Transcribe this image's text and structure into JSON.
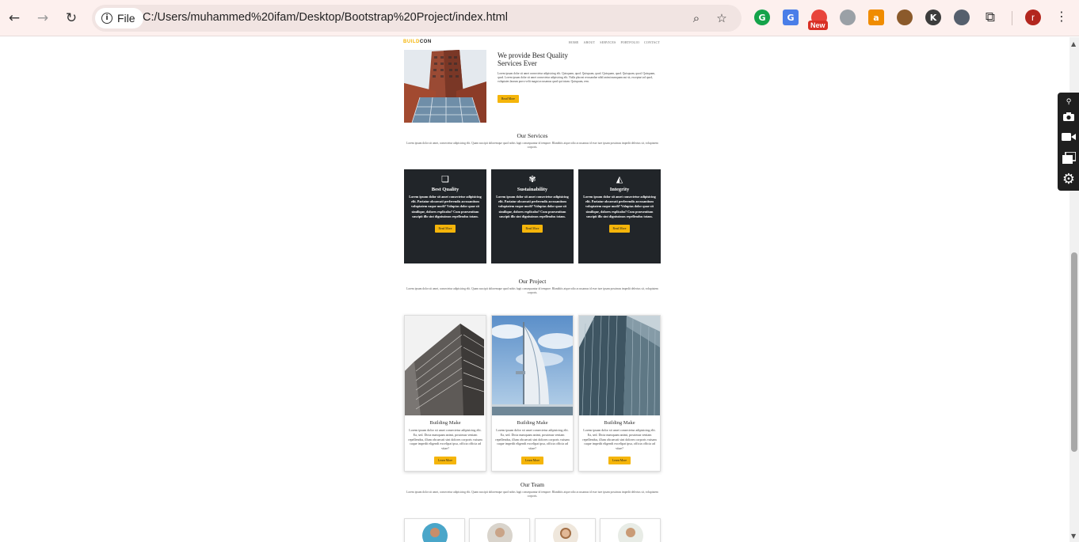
{
  "browser": {
    "file_label": "File",
    "url": "C:/Users/muhammed%20ifam/Desktop/Bootstrap%20Project/index.html",
    "new_badge": "New",
    "profile_initial": "r",
    "ext_k_letter": "K",
    "icons": {
      "back": "←",
      "forward": "→",
      "reload": "↻",
      "zoom": "⌕",
      "star": "☆",
      "puzzle": "⧉",
      "menu": "⋮",
      "info": "i"
    }
  },
  "site": {
    "brand_part1": "BUILD",
    "brand_part2": "CON",
    "nav": [
      "HOME",
      "ABOUT",
      "SERVICES",
      "PORTFOLIO",
      "CONTACT"
    ],
    "about": {
      "title": "We provide Best Quality Services Ever",
      "body": "Lorem ipsum dolor sit amet consectetur adipisicing elit. Quisquam, quod. Quisquam, quod. Quisquam, quod. Quisquam, quod. Quisquam, quod. Lorem ipsum dolor sit amet consectetur adipisicing elit. Nulla placeat recusandae nihil animi numquam aut sit, excepturi ad quod, voluptates laurum porro velit magni accusamus quod qui totam. Quisquam, rem.",
      "button": "Read More"
    },
    "services_section": {
      "title": "Our Services",
      "body": "Lorem ipsum dolor sit amet, consectetur adipisicing elit. Quam suscipit doloremque quod nobis fugit consequuntur id tempore. Blanditiis atque odio accusamus id esse iure ipsam possimus impedit delectus sit, voluptatem corporis.",
      "cards": [
        {
          "icon": "❏",
          "title": "Best Quality",
          "body": "Lorem ipsum dolor sit amet consectetur adipisicing elit. Pariatur obcaecati perferendis accusantium voluptatem eaque modi? Voluptas dolor quae sit similique, dolores explicabo? Cum praesentium suscipit illo sint dignissimos repellendus totam.",
          "button": "Read More"
        },
        {
          "icon": "✾",
          "title": "Sustainability",
          "body": "Lorem ipsum dolor sit amet consectetur adipisicing elit. Pariatur obcaecati perferendis accusantium voluptatem eaque modi? Voluptas dolor quae sit similique, dolores explicabo? Cum praesentium suscipit illo sint dignissimos repellendus totam.",
          "button": "Read More"
        },
        {
          "icon": "◭",
          "title": "Integrity",
          "body": "Lorem ipsum dolor sit amet consectetur adipisicing elit. Pariatur obcaecati perferendis accusantium voluptatem eaque modi? Voluptas dolor quae sit similique, dolores explicabo? Cum praesentium suscipit illo sint dignissimos repellendus totam.",
          "button": "Read More"
        }
      ]
    },
    "project_section": {
      "title": "Our Project",
      "body": "Lorem ipsum dolor sit amet, consectetur adipisicing elit. Quam suscipit doloremque quod nobis fugit consequuntur id tempore. Blanditiis atque odio accusamus id esse iure ipsam possimus impedit delectus sit, voluptatem corporis.",
      "cards": [
        {
          "title": "Building Make",
          "body": "Lorem ipsum dolor sit amet consectetur adipisicing elit. Ea, sed. Dicta numquam animi, possimus veniam repellendus, illum obcaecati sint dolores corporis vuisam caque impedit eligendi excelipat ipsa, officia officia ad vitae?",
          "button": "Learn More"
        },
        {
          "title": "Building Make",
          "body": "Lorem ipsum dolor sit amet consectetur adipisicing elit. Ea, sed. Dicta numquam animi, possimus veniam repellendus, illum obcaecati sint dolores corporis vuisam caque impedit eligendi excelipat ipsa, officia officia ad vitae?",
          "button": "Learn More"
        },
        {
          "title": "Building Make",
          "body": "Lorem ipsum dolor sit amet consectetur adipisicing elit. Ea, sed. Dicta numquam animi, possimus veniam repellendus, illum obcaecati sint dolores corporis vuisam caque impedit eligendi excelipat ipsa, officia officia ad vitae?",
          "button": "Learn More"
        }
      ]
    },
    "team_section": {
      "title": "Our Team",
      "body": "Lorem ipsum dolor sit amet, consectetur adipisicing elit. Quam suscipit doloremque quod nobis fugit consequuntur id tempore. Blanditiis atque odio accusamus id esse iure ipsam possimus impedit delectus sit, voluptatem corporis."
    }
  },
  "colors": {
    "accent": "#f5b50a",
    "dark_card": "#212529",
    "chrome_bg": "#fdf0ee"
  }
}
